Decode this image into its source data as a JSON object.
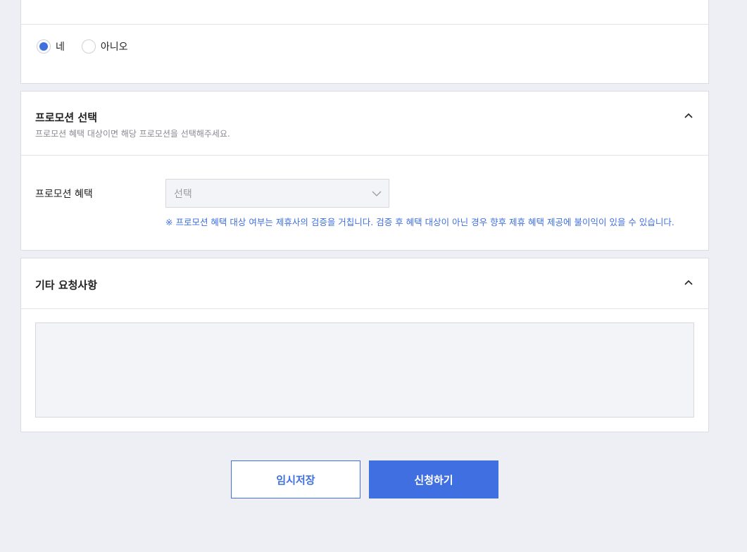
{
  "radio_group": {
    "options": [
      {
        "label": "네",
        "checked": true
      },
      {
        "label": "아니오",
        "checked": false
      }
    ]
  },
  "promotion": {
    "title": "프로모션 선택",
    "subtitle": "프로모션 혜택 대상이면 해당 프로모션을 선택해주세요.",
    "field_label": "프로모션 혜택",
    "select_value": "선택",
    "notice": "※ 프로모션 혜택 대상 여부는 제휴사의 검증을 거칩니다. 검증 후 혜택 대상이 아닌 경우 향후 제휴 혜택 제공에 불이익이 있을 수 있습니다."
  },
  "etc": {
    "title": "기타 요청사항",
    "textarea_value": ""
  },
  "actions": {
    "save_label": "임시저장",
    "apply_label": "신청하기"
  },
  "colors": {
    "accent": "#3f6fe0",
    "background": "#eeeff4",
    "notice_text": "#3f6fe0"
  },
  "icons": [
    "chevron-up-icon",
    "chevron-down-icon",
    "radio-checked-icon",
    "radio-unchecked-icon"
  ]
}
